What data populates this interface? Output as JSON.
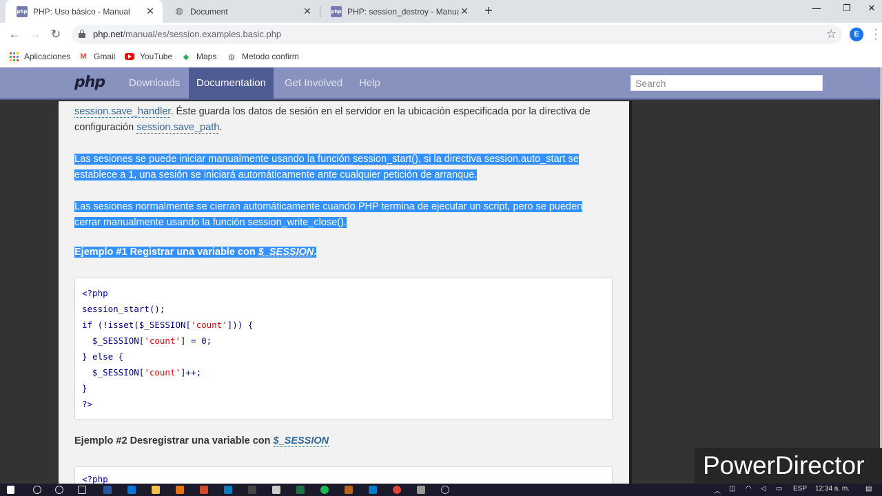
{
  "browser": {
    "tabs": [
      {
        "title": "PHP: Uso básico - Manual",
        "icon": "php-favicon",
        "active": true
      },
      {
        "title": "Document",
        "icon": "globe-icon",
        "active": false
      },
      {
        "title": "PHP: session_destroy - Manual",
        "icon": "php-favicon",
        "active": false
      }
    ],
    "url_host": "php.net",
    "url_path": "/manual/es/session.examples.basic.php",
    "profile_initial": "E",
    "favicon_text": "php",
    "new_tab": "+",
    "close": "✕"
  },
  "bookmarks": [
    {
      "label": "Aplicaciones",
      "icon": "apps-icon"
    },
    {
      "label": "Gmail",
      "icon": "gmail-icon"
    },
    {
      "label": "YouTube",
      "icon": "youtube-icon"
    },
    {
      "label": "Maps",
      "icon": "maps-icon"
    },
    {
      "label": "Metodo confirm",
      "icon": "globe-icon"
    }
  ],
  "site": {
    "logo": "php",
    "nav": [
      "Downloads",
      "Documentation",
      "Get Involved",
      "Help"
    ],
    "active_nav": "Documentation",
    "search_placeholder": "Search"
  },
  "content": {
    "p1_link1": "session.save_handler",
    "p1_text1": ". Éste guarda los datos de sesión en el servidor en la ubicación especificada por la directiva de configuración ",
    "p1_link2": "session.save_path",
    "p1_text2": ".",
    "p2_text1": "Las sesiones se puede iniciar manualmente usando la función ",
    "p2_link": "session_start()",
    "p2_text2": ", si la directiva session.auto_start se establece a 1, una sesión se iniciará automáticamente ante cualquier petición de arranque.",
    "p3_text": "Las sesiones normalmente se cierran automáticamente cuando PHP termina de ejecutar un script, pero se pueden cerrar manualmente usando la función session_write_close().",
    "example1_label": "Ejemplo #1 Registrar una variable con ",
    "example1_var": "$_SESSION",
    "example1_end": ".",
    "code1": [
      "<?php",
      "session_start();",
      "if (!isset($_SESSION['count'])) {",
      "  $_SESSION['count'] = 0;",
      "} else {",
      "  $_SESSION['count']++;",
      "}",
      "?>"
    ],
    "example2_label": "Ejemplo #2 Desregistrar una variable con ",
    "example2_var": "$_SESSION",
    "code2_first": "<?php"
  },
  "watermark": "PowerDirector",
  "taskbar": {
    "lang": "ESP",
    "time": "12:34 a. m."
  },
  "colors": {
    "php_nav": "#8892bf",
    "php_nav_active": "#4f5b93",
    "selection": "#3390ff",
    "link": "#336699"
  }
}
